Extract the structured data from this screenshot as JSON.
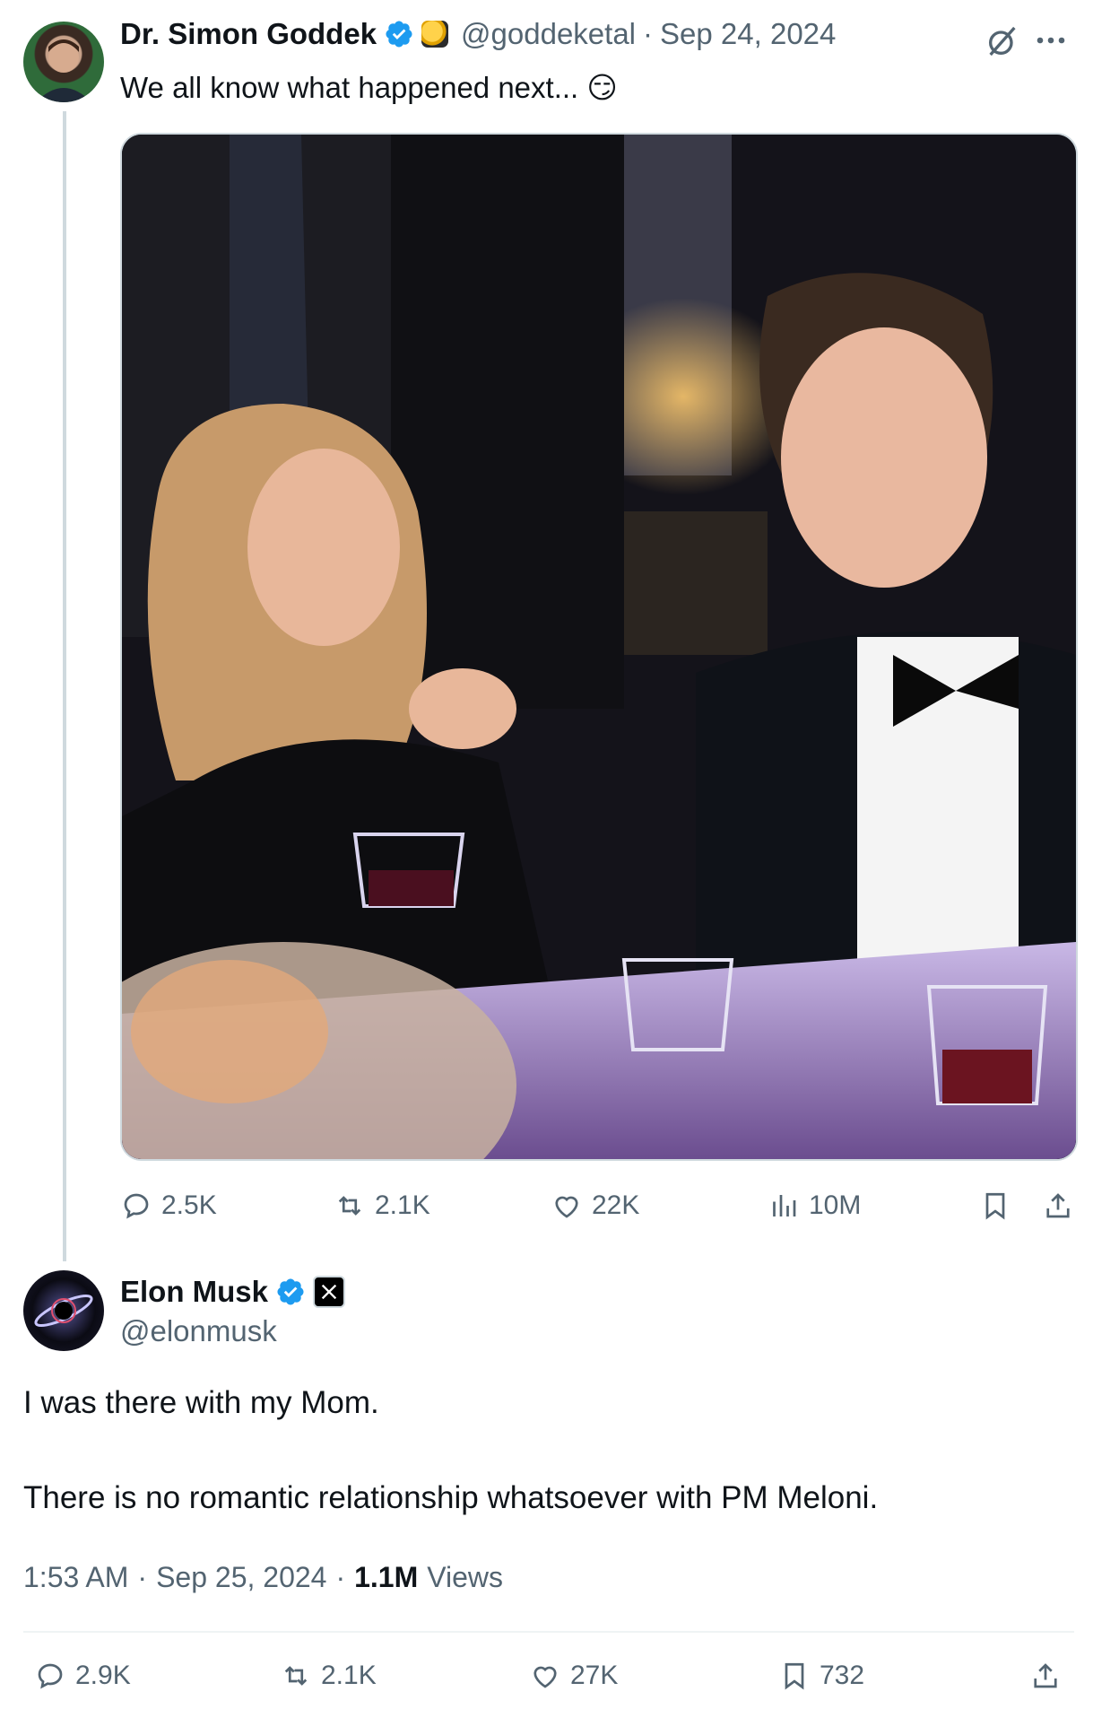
{
  "quoted_tweet": {
    "author_name": "Dr. Simon Goddek",
    "handle": "@goddeketal",
    "separator": "·",
    "date": "Sep 24, 2024",
    "text": "We all know what happened next... 😏",
    "stats": {
      "replies": "2.5K",
      "reposts": "2.1K",
      "likes": "22K",
      "views": "10M"
    }
  },
  "main_tweet": {
    "author_name": "Elon Musk",
    "handle": "@elonmusk",
    "line1": "I was there with my Mom.",
    "line2": "There is no romantic relationship whatsoever with PM Meloni.",
    "time": "1:53 AM",
    "separator": "·",
    "date": "Sep 25, 2024",
    "separator2": "·",
    "views_count": "1.1M",
    "views_label": "Views",
    "stats": {
      "replies": "2.9K",
      "reposts": "2.1K",
      "likes": "27K",
      "bookmarks": "732"
    }
  },
  "colors": {
    "verified": "#1d9bf0",
    "secondary_text": "#536471",
    "divider": "#eff3f4"
  }
}
